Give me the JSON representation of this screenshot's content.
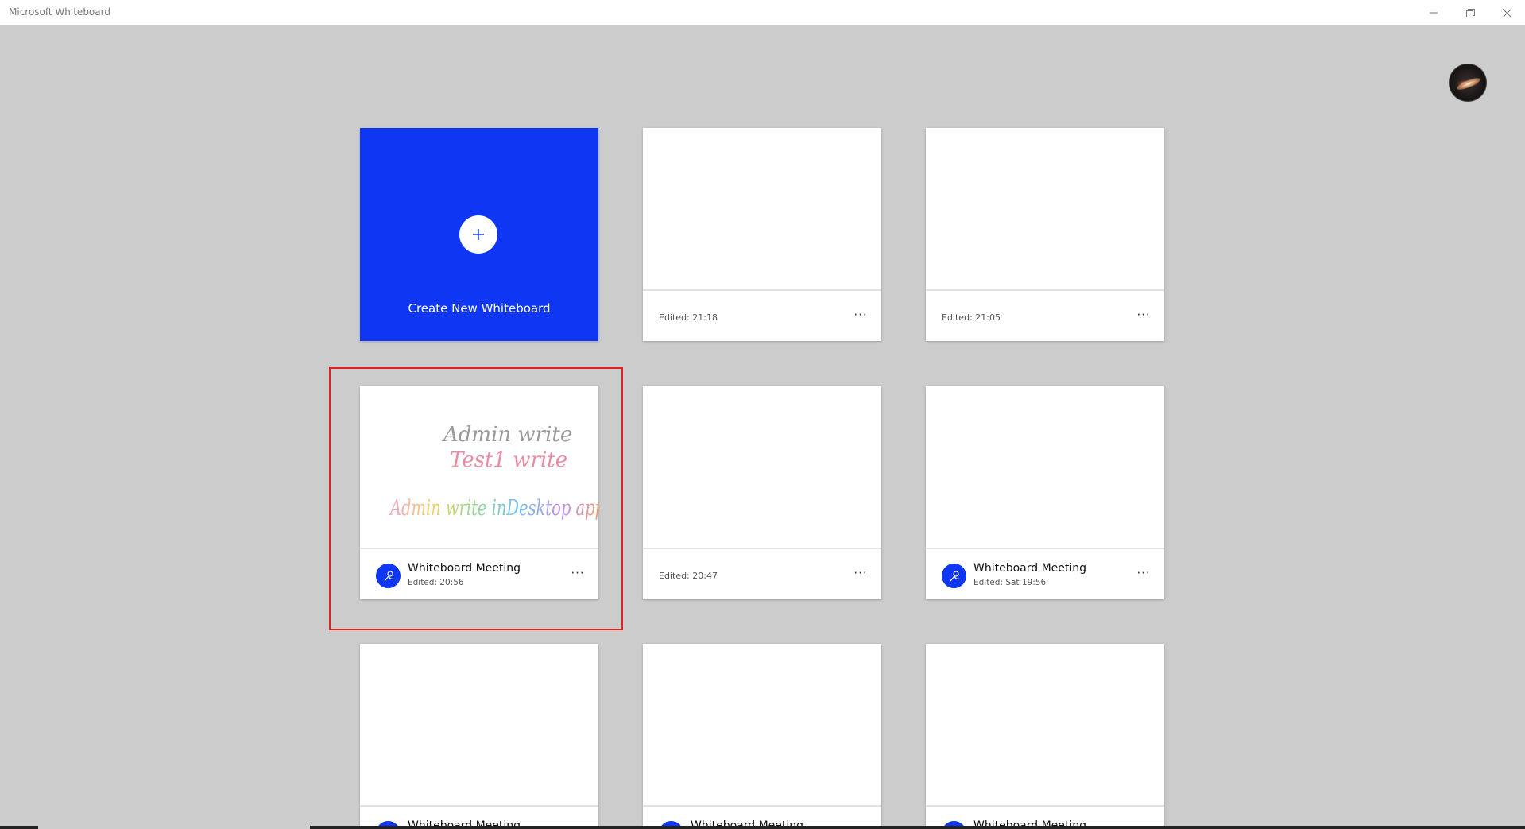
{
  "window": {
    "title": "Microsoft Whiteboard",
    "minimize_icon": "minimize-icon",
    "restore_icon": "restore-icon",
    "close_icon": "close-icon"
  },
  "user": {
    "avatar_icon": "galaxy-avatar"
  },
  "create": {
    "label": "Create New Whiteboard",
    "icon": "plus-icon"
  },
  "boards": [
    {
      "title": "",
      "edited": "Edited: 21:18",
      "shared": false
    },
    {
      "title": "",
      "edited": "Edited: 21:05",
      "shared": false
    },
    {
      "title": "Whiteboard Meeting",
      "edited": "Edited: 20:56",
      "shared": true,
      "preview_text": [
        "Admin write",
        "Test1 write",
        "Admin write inDesktop app"
      ]
    },
    {
      "title": "",
      "edited": "Edited: 20:47",
      "shared": false
    },
    {
      "title": "Whiteboard Meeting",
      "edited": "Edited: Sat 19:56",
      "shared": true
    },
    {
      "title": "Whiteboard Meeting",
      "edited": "",
      "shared": true
    },
    {
      "title": "Whiteboard Meeting",
      "edited": "",
      "shared": true
    },
    {
      "title": "Whiteboard Meeting",
      "edited": "",
      "shared": true
    }
  ],
  "more_label": "···",
  "colors": {
    "accent": "#0f36f2",
    "background": "#cccccc",
    "highlight": "#e02020"
  }
}
